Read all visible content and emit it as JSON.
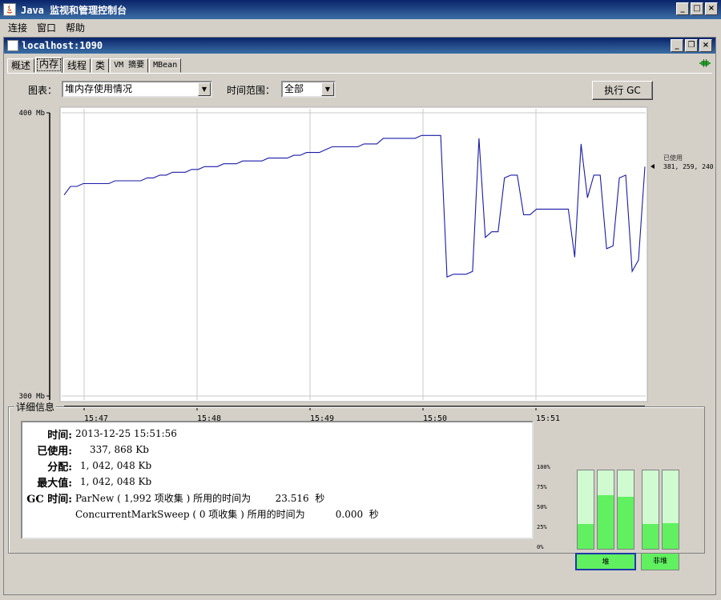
{
  "window": {
    "title": "Java 监视和管理控制台"
  },
  "menu": {
    "items": [
      "连接",
      "窗口",
      "帮助"
    ]
  },
  "conn": {
    "title": "localhost:1090"
  },
  "tabs": [
    "概述",
    "内存",
    "线程",
    "类",
    "VM 摘要",
    "MBean"
  ],
  "toolbar": {
    "chart_label": "图表：",
    "chart_value": "堆内存使用情况",
    "range_label": "时间范围：",
    "range_value": "全部",
    "gc_button": "执行 GC"
  },
  "chart_data": {
    "type": "line",
    "ylim": [
      300,
      400
    ],
    "yticks": [
      "400 Mb",
      "300 Mb"
    ],
    "xticks": [
      "15:47",
      "15:48",
      "15:49",
      "15:50",
      "15:51"
    ],
    "series": [
      {
        "name": "已使用",
        "color": "#1a1aa8",
        "values": [
          371,
          374,
          374,
          375,
          375,
          375,
          375,
          375,
          376,
          376,
          376,
          376,
          376,
          377,
          377,
          378,
          378,
          379,
          379,
          379,
          380,
          380,
          381,
          381,
          381,
          382,
          382,
          382,
          383,
          383,
          383,
          383,
          384,
          384,
          384,
          384,
          385,
          385,
          386,
          386,
          386,
          387,
          388,
          388,
          388,
          388,
          388,
          389,
          389,
          389,
          391,
          391,
          391,
          391,
          391,
          391,
          392,
          392,
          392,
          392,
          342,
          343,
          343,
          343,
          344,
          391,
          356,
          358,
          358,
          377,
          378,
          378,
          364,
          364,
          366,
          366,
          366,
          366,
          366,
          366,
          349,
          389,
          370,
          378,
          378,
          352,
          353,
          377,
          378,
          344,
          348,
          381
        ]
      }
    ],
    "current_label": "已使用",
    "current_value": "381, 259, 240"
  },
  "details": {
    "legend": "详细信息",
    "rows": [
      {
        "key": "时间:",
        "value": "2013-12-25 15:51:56"
      },
      {
        "key": "已使用:",
        "value": "337, 868 Kb"
      },
      {
        "key": "分配:",
        "value": "1, 042, 048 Kb"
      },
      {
        "key": "最大值:",
        "value": "1, 042, 048 Kb"
      },
      {
        "key": "GC 时间:",
        "value": "ParNew ( 1,992 项收集 ) 所用的时间为        23.516  秒"
      },
      {
        "key": "",
        "value": "ConcurrentMarkSweep ( 0 项收集 ) 所用的时间为          0.000  秒"
      }
    ]
  },
  "pools": {
    "pct_labels": [
      "100%",
      "75%",
      "50%",
      "25%",
      "0%"
    ],
    "heap_levels": [
      0.32,
      0.68,
      0.66
    ],
    "nonheap_levels": [
      0.32,
      0.33
    ],
    "heap_label": "堆",
    "nonheap_label": "非堆"
  }
}
